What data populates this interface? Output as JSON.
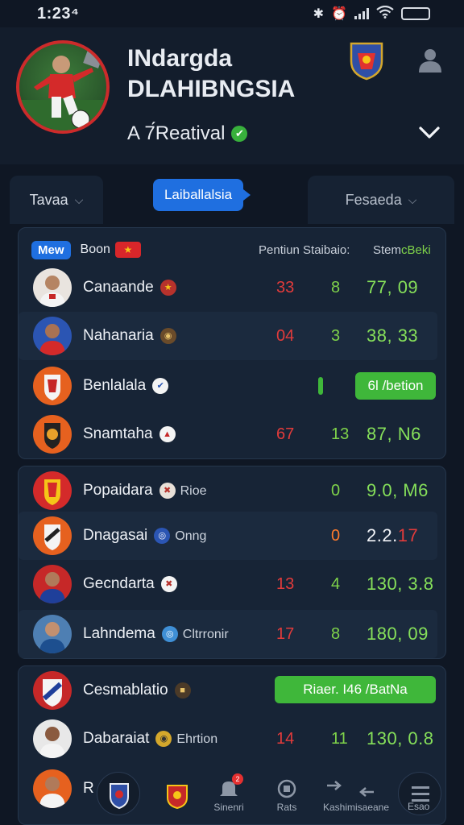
{
  "status_bar": {
    "time": "1:23⁴"
  },
  "header": {
    "title_line1": "INdargda",
    "title_line2": "DLAHIBNGSIA",
    "subtitle": "A 7́Reatival",
    "verified_mark": "✔"
  },
  "filters": {
    "left": "Tavaa",
    "middle": "Laiballalsia",
    "right": "Fesaeda"
  },
  "table": {
    "new_badge": "Mew",
    "title": "Boon",
    "col_head_1": "Pentiun Staibaio:",
    "col_head_2a": "Stem",
    "col_head_2b": "cBeki"
  },
  "rows": [
    {
      "name": "Canaande",
      "c1": "33",
      "c2": "8",
      "c3": "77, 09"
    },
    {
      "name": "Nahanaria",
      "c1": "04",
      "c2": "3",
      "c3": "38, 33"
    },
    {
      "name": "Benlalala",
      "button": "6l /betion"
    },
    {
      "name": "Snamtaha",
      "c1": "67",
      "c2": "13",
      "c3": "87, N6"
    },
    {
      "name": "Popaidara",
      "extra": "Rioe",
      "c2": "0",
      "c3": "9.0, M6"
    },
    {
      "name": "Dnagasai",
      "extra": "Onng",
      "c2": "0",
      "c3a": "2.2.",
      "c3b": "17"
    },
    {
      "name": "Gecndarta",
      "c1": "13",
      "c2": "4",
      "c3": "130, 3.8"
    },
    {
      "name": "Lahndema",
      "extra": "Cltrronir",
      "c1": "17",
      "c2": "8",
      "c3": "180, 09"
    },
    {
      "name": "Cesmablatio",
      "button": "Riaer. I46 /BatNa"
    },
    {
      "name": "Dabaraiat",
      "extra": "Ehrtion",
      "c1": "14",
      "c2": "11",
      "c3": "130, 0.8"
    },
    {
      "name": "R"
    }
  ],
  "nav": {
    "item3": "Sinenri",
    "item4": "Rats",
    "item5": "Kashimisaeane",
    "item6": "Esao",
    "badge3": "2"
  },
  "colors": {
    "accent_blue": "#1f6fe0",
    "accent_green": "#3fb73a",
    "negative_red": "#e23b3b",
    "background": "#0f1724"
  }
}
